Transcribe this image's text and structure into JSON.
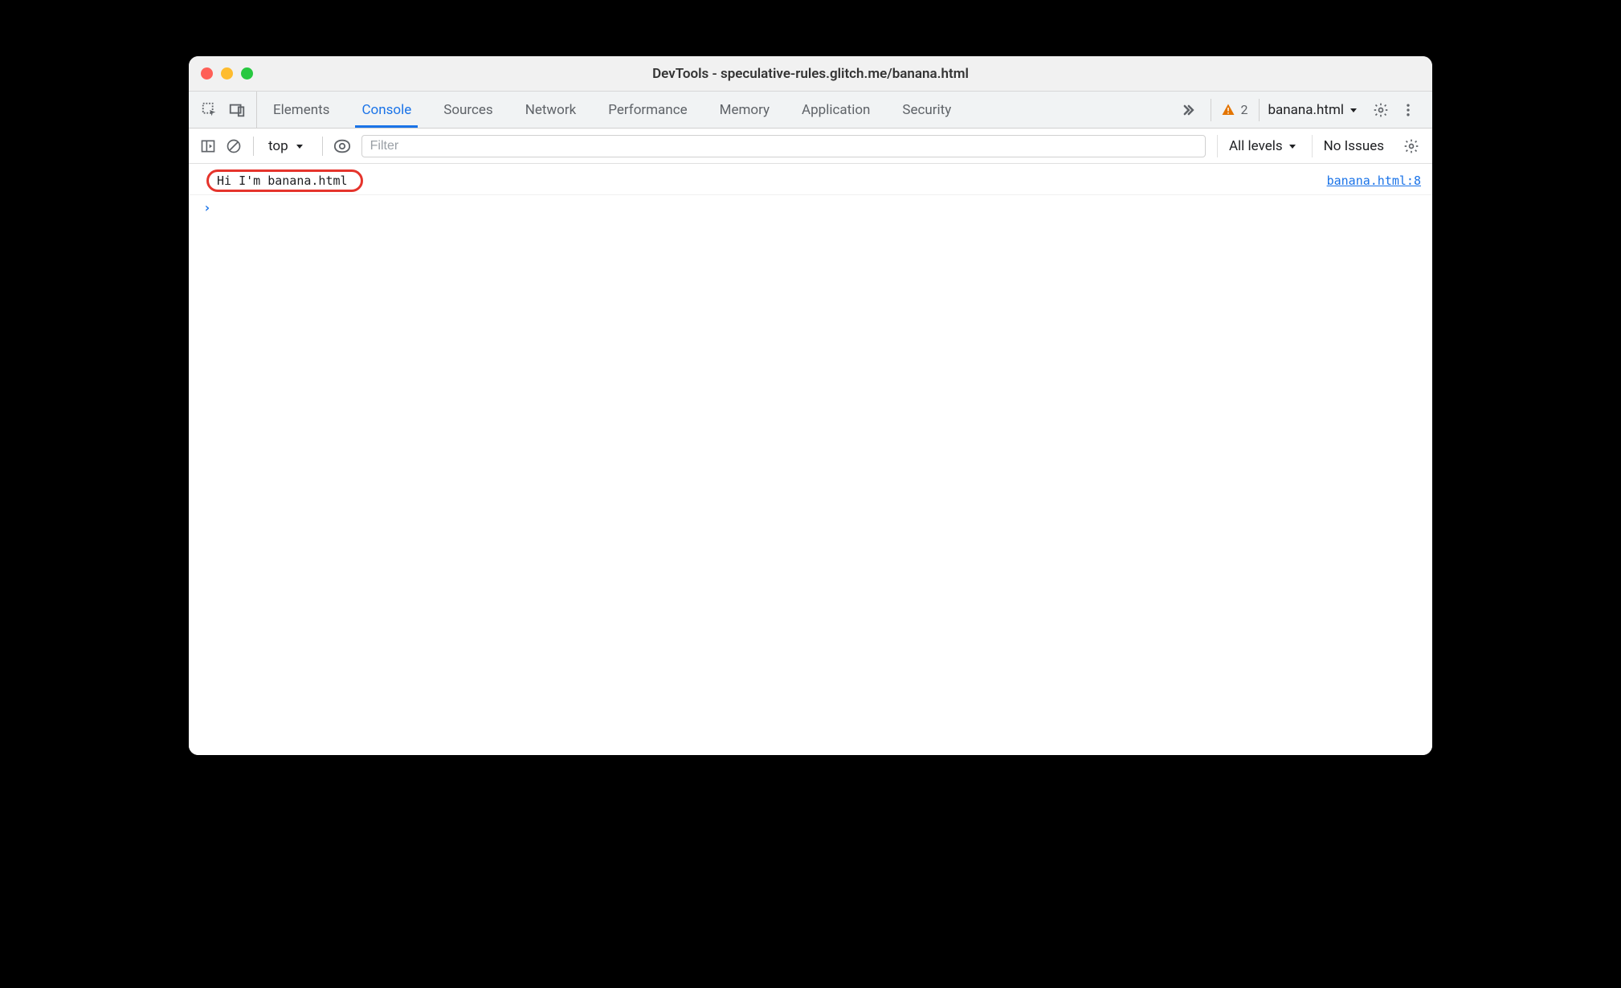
{
  "window": {
    "title": "DevTools - speculative-rules.glitch.me/banana.html"
  },
  "tabs": {
    "items": [
      "Elements",
      "Console",
      "Sources",
      "Network",
      "Performance",
      "Memory",
      "Application",
      "Security"
    ],
    "active": "Console"
  },
  "toolbar_right": {
    "warning_count": "2",
    "context_target": "banana.html"
  },
  "console_toolbar": {
    "execution_context": "top",
    "filter_placeholder": "Filter",
    "levels_label": "All levels",
    "issues_label": "No Issues"
  },
  "console": {
    "rows": [
      {
        "message": "Hi I'm banana.html",
        "source": "banana.html:8",
        "highlighted": true
      }
    ]
  }
}
